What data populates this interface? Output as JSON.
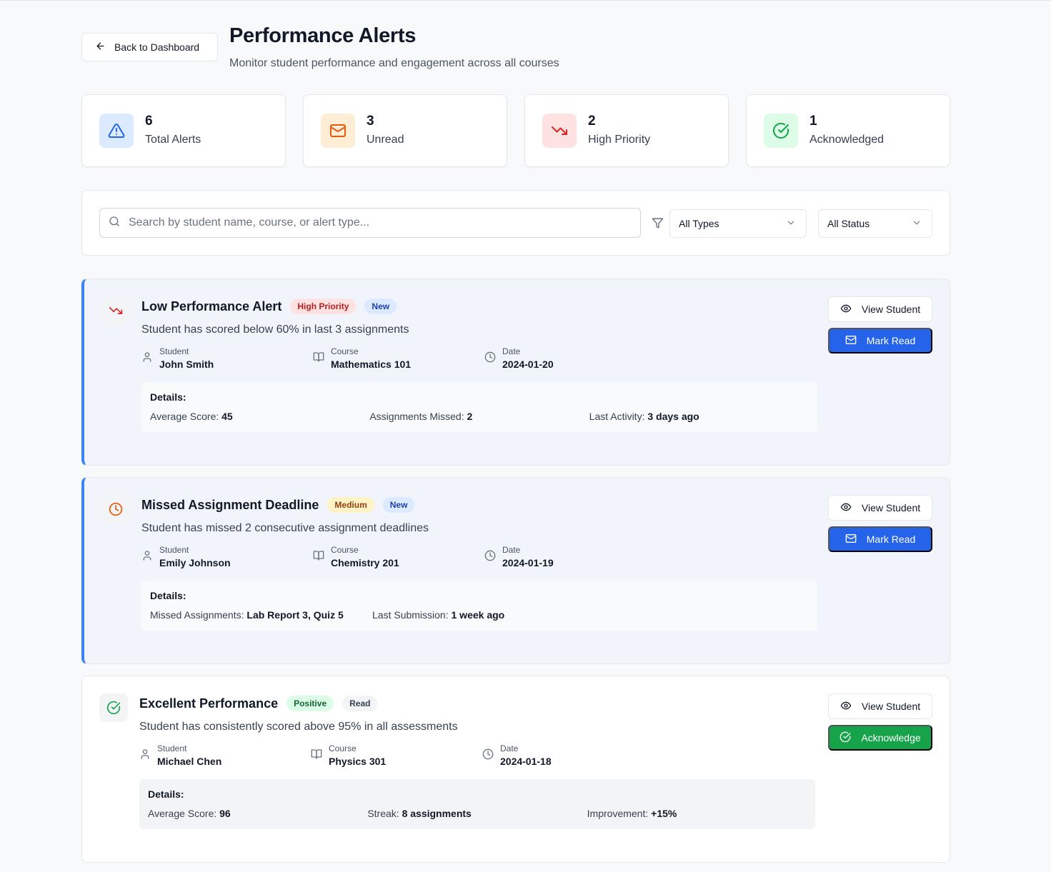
{
  "header": {
    "back_label": "Back to Dashboard",
    "title": "Performance Alerts",
    "subtitle": "Monitor student performance and engagement across all courses"
  },
  "stats": [
    {
      "value": "6",
      "label": "Total Alerts",
      "icon": "alert-triangle-icon",
      "color": "#2563eb",
      "bg": "#dbeafe"
    },
    {
      "value": "3",
      "label": "Unread",
      "icon": "mail-icon",
      "color": "#ea580c",
      "bg": "#ffedd5"
    },
    {
      "value": "2",
      "label": "High Priority",
      "icon": "trending-down-icon",
      "color": "#dc2626",
      "bg": "#fee2e2"
    },
    {
      "value": "1",
      "label": "Acknowledged",
      "icon": "check-circle-icon",
      "color": "#16a34a",
      "bg": "#dcfce7"
    }
  ],
  "filters": {
    "search_placeholder": "Search by student name, course, or alert type...",
    "search_value": "",
    "type_selected": "All Types",
    "status_selected": "All Status"
  },
  "meta_labels": {
    "student": "Student",
    "course": "Course",
    "date": "Date"
  },
  "details_title": "Details:",
  "buttons": {
    "view": "View Student",
    "mark_read": "Mark Read",
    "acknowledge": "Acknowledge"
  },
  "alerts": [
    {
      "title": "Low Performance Alert",
      "priority": "High Priority",
      "status": "New",
      "description": "Student has scored below 60% in last 3 assignments",
      "student": "John Smith",
      "course": "Mathematics 101",
      "date": "2024-01-20",
      "details": [
        {
          "label": "Average Score:",
          "value": "45"
        },
        {
          "label": "Assignments Missed:",
          "value": "2"
        },
        {
          "label": "Last Activity:",
          "value": "3 days ago"
        }
      ]
    },
    {
      "title": "Missed Assignment Deadline",
      "priority": "Medium",
      "status": "New",
      "description": "Student has missed 2 consecutive assignment deadlines",
      "student": "Emily Johnson",
      "course": "Chemistry 201",
      "date": "2024-01-19",
      "details": [
        {
          "label": "Missed Assignments:",
          "value": "Lab Report 3, Quiz 5"
        },
        {
          "label": "Last Submission:",
          "value": "1 week ago"
        }
      ]
    },
    {
      "title": "Excellent Performance",
      "priority": "Positive",
      "status": "Read",
      "description": "Student has consistently scored above 95% in all assessments",
      "student": "Michael Chen",
      "course": "Physics 301",
      "date": "2024-01-18",
      "details": [
        {
          "label": "Average Score:",
          "value": "96"
        },
        {
          "label": "Streak:",
          "value": "8 assignments"
        },
        {
          "label": "Improvement:",
          "value": "+15%"
        }
      ]
    }
  ]
}
